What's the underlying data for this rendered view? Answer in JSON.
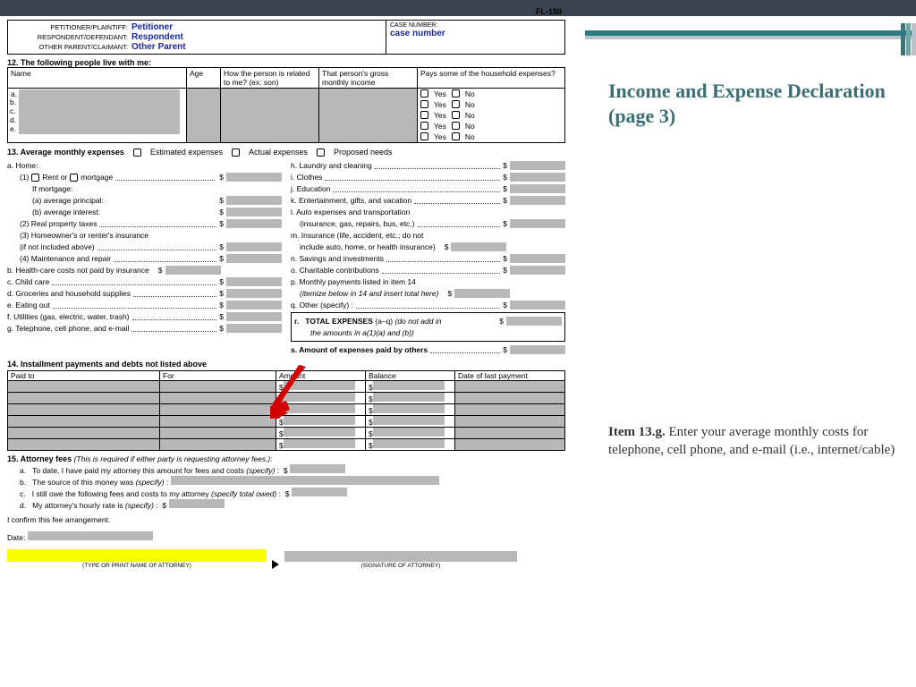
{
  "form_no": "FL-150",
  "header": {
    "petitioner_label": "PETITIONER/PLAINTIFF:",
    "petitioner_value": "Petitioner",
    "respondent_label": "RESPONDENT/DEFENDANT:",
    "respondent_value": "Respondent",
    "other_label": "OTHER PARENT/CLAIMANT:",
    "other_value": "Other Parent",
    "case_label": "CASE NUMBER:",
    "case_value": "case number"
  },
  "s12": {
    "title": "12.  The following people live with me:",
    "cols": {
      "name": "Name",
      "age": "Age",
      "rel": "How the person is related to me? (ex: son)",
      "inc": "That person's gross monthly income",
      "pays": "Pays some of the household expenses?"
    },
    "rows": [
      "a.",
      "b.",
      "c.",
      "d.",
      "e."
    ],
    "yes": "Yes",
    "no": "No"
  },
  "s13": {
    "title": "13.  Average monthly expenses",
    "opt_est": "Estimated expenses",
    "opt_act": "Actual expenses",
    "opt_prop": "Proposed needs",
    "left": {
      "a": "a. Home:",
      "a1": "(1)",
      "rent": "Rent or",
      "mort": "mortgage",
      "ifmort": "If mortgage:",
      "a1a": "(a)   average principal:",
      "a1b": "(b)   average interest:",
      "a2": "(2) Real property taxes",
      "a3": "(3) Homeowner's or renter's insurance",
      "a3b": "(if not included above)",
      "a4": "(4) Maintenance and repair",
      "b": "b. Health-care costs not paid by insurance",
      "c": "c. Child care",
      "d": "d. Groceries and household supplies",
      "e": "e. Eating out",
      "f": "f. Utilities (gas, electric, water, trash)",
      "g": "g. Telephone, cell phone, and e-mail"
    },
    "right": {
      "h": "h. Laundry and cleaning",
      "i": "i. Clothes",
      "j": "j. Education",
      "k": "k. Entertainment, gifts, and vacation",
      "l": "l. Auto expenses and transportation",
      "lb": "(insurance, gas, repairs, bus, etc.)",
      "m": "m. Insurance (life, accident, etc.; do not",
      "mb": "include auto, home, or health insurance)",
      "n": "n. Savings and investments",
      "o": "o. Charitable contributions",
      "p": "p. Monthly payments listed in item 14",
      "pb": "(itemize below in 14 and insert total here)",
      "q": "q. Other (specify) :",
      "r": "r.   TOTAL EXPENSES (a–q) (do not add in",
      "rb": "the amounts in a(1)(a) and (b))",
      "s": "s.   Amount of expenses paid by others"
    }
  },
  "s14": {
    "title": "14.  Installment payments and debts not listed above",
    "cols": {
      "paid": "Paid to",
      "for": "For",
      "amt": "Amount",
      "bal": "Balance",
      "date": "Date of last payment"
    }
  },
  "s15": {
    "title": "15.  Attorney fees",
    "sub": "(This is required if either party is requesting attorney fees.):",
    "a": "a.   To date, I have paid my attorney this amount for fees and costs (specify) :  $",
    "b": "b.   The source of this money was (specify) :",
    "c": "c.   I still owe the following fees and costs to my attorney (specify total owed) :  $",
    "d": "d.   My attorney's hourly rate is (specify) :  $",
    "confirm": "I confirm this fee arrangement.",
    "date": "Date:",
    "cap1": "(TYPE OR PRINT NAME OF ATTORNEY)",
    "cap2": "(SIGNATURE OF ATTORNEY)"
  },
  "side": {
    "heading": "Income and Expense Declaration (page 3)",
    "item": "Item 13.g.",
    "text": "  Enter your average monthly costs for telephone, cell phone, and e-mail (i.e., internet/cable)"
  }
}
